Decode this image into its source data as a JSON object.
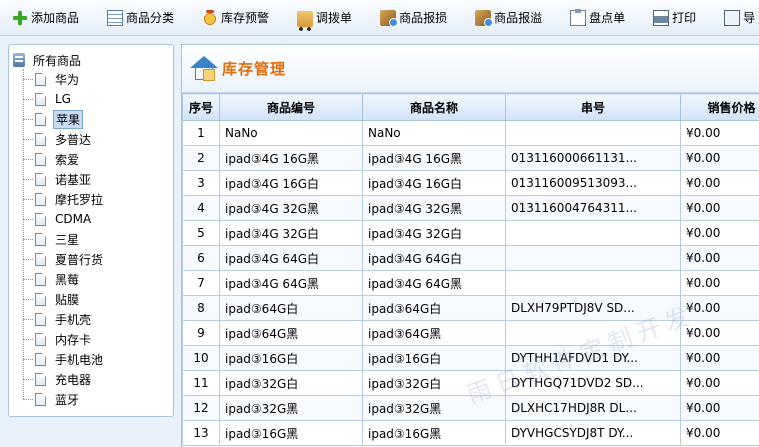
{
  "toolbar": {
    "buttons": [
      {
        "label": "添加商品",
        "icon": "plus-icon"
      },
      {
        "label": "商品分类",
        "icon": "grid-icon"
      },
      {
        "label": "库存预警",
        "icon": "alarm-icon"
      },
      {
        "label": "调拨单",
        "icon": "truck-icon"
      },
      {
        "label": "商品报损",
        "icon": "box-icon"
      },
      {
        "label": "商品报溢",
        "icon": "box-icon"
      },
      {
        "label": "盘点单",
        "icon": "clipboard-icon"
      },
      {
        "label": "打印",
        "icon": "printer-icon"
      },
      {
        "label": "导",
        "icon": "export-icon"
      }
    ]
  },
  "tree": {
    "root": "所有商品",
    "items": [
      "华为",
      "LG",
      "苹果",
      "多普达",
      "索爱",
      "诺基亚",
      "摩托罗拉",
      "CDMA",
      "三星",
      "夏普行货",
      "黑莓",
      "贴膜",
      "手机壳",
      "内存卡",
      "手机电池",
      "充电器",
      "蓝牙"
    ],
    "selected_index": 2
  },
  "content": {
    "title": "库存管理",
    "columns": [
      "序号",
      "商品编号",
      "商品名称",
      "串号",
      "销售价格"
    ],
    "rows": [
      [
        "1",
        "NaNo",
        "NaNo",
        "",
        "¥0.00"
      ],
      [
        "2",
        "ipad③4G 16G黑",
        "ipad③4G 16G黑",
        "01311600066113​1...",
        "¥0.00"
      ],
      [
        "3",
        "ipad③4G 16G白",
        "ipad③4G 16G白",
        "01311600951309​3...",
        "¥0.00"
      ],
      [
        "4",
        "ipad③4G 32G黑",
        "ipad③4G 32G黑",
        "01311600476431​1...",
        "¥0.00"
      ],
      [
        "5",
        "ipad③4G 32G白",
        "ipad③4G 32G白",
        "",
        "¥0.00"
      ],
      [
        "6",
        "ipad③4G 64G白",
        "ipad③4G 64G白",
        "",
        "¥0.00"
      ],
      [
        "7",
        "ipad③4G 64G黑",
        "ipad③4G 64G黑",
        "",
        "¥0.00"
      ],
      [
        "8",
        "ipad③64G白",
        "ipad③64G白",
        "DLXH79PTDJ8V SD...",
        "¥0.00"
      ],
      [
        "9",
        "ipad③64G黑",
        "ipad③64G黑",
        "",
        "¥0.00"
      ],
      [
        "10",
        "ipad③16G白",
        "ipad③16G白",
        "DYTHH1AFDVD1 DY...",
        "¥0.00"
      ],
      [
        "11",
        "ipad③32G白",
        "ipad③32G白",
        "DYTHGQ71DVD2 SD...",
        "¥0.00"
      ],
      [
        "12",
        "ipad③32G黑",
        "ipad③32G黑",
        "DLXHC17HDJ8R DL...",
        "¥0.00"
      ],
      [
        "13",
        "ipad③16G黑",
        "ipad③16G黑",
        "DYVHGCSYDJ8T DY...",
        "¥0.00"
      ]
    ]
  },
  "watermark": "雨日软件定制开发"
}
